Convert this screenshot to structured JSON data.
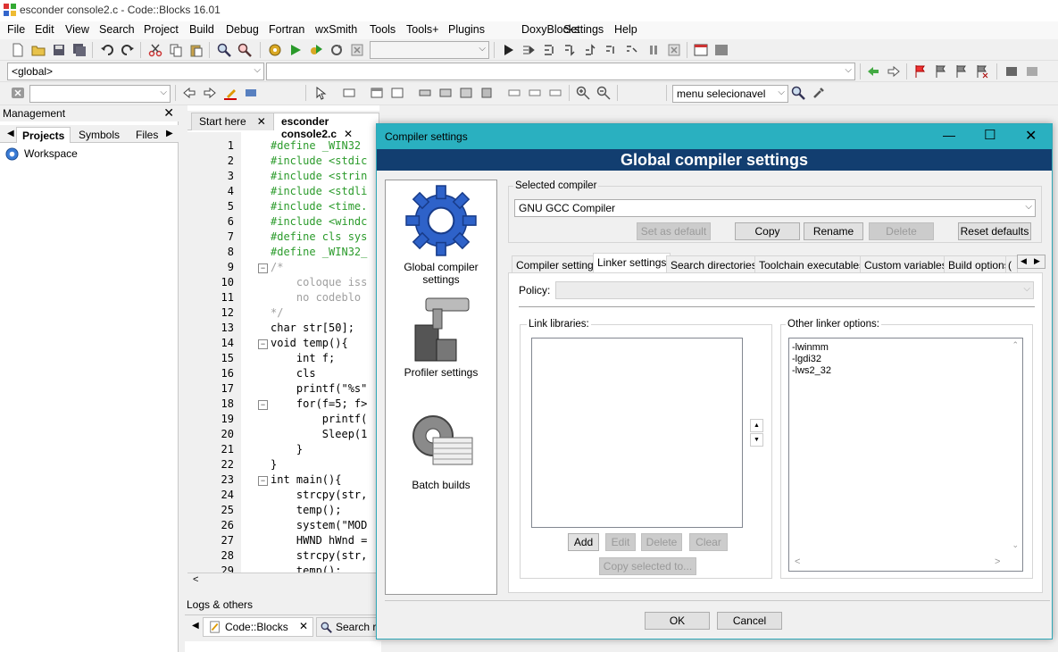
{
  "window": {
    "title": "esconder console2.c - Code::Blocks 16.01"
  },
  "menu": [
    "File",
    "Edit",
    "View",
    "Search",
    "Project",
    "Build",
    "Debug",
    "Fortran",
    "wxSmith",
    "Tools",
    "Tools+",
    "Plugins",
    "DoxyBlocks",
    "Settings",
    "Help"
  ],
  "toolbar": {
    "scope_combo": "<global>",
    "find_combo": "menu  selecionavel"
  },
  "management": {
    "title": "Management",
    "tabs": [
      "Projects",
      "Symbols",
      "Files"
    ],
    "tree_root": "Workspace"
  },
  "editor": {
    "tabs": [
      "Start here",
      "esconder console2.c"
    ],
    "lines": [
      {
        "n": "1",
        "text": "#define _WIN32",
        "cls": "pp"
      },
      {
        "n": "2",
        "text": "#include <stdic",
        "cls": "pp"
      },
      {
        "n": "3",
        "text": "#include <strin",
        "cls": "pp"
      },
      {
        "n": "4",
        "text": "#include <stdli",
        "cls": "pp"
      },
      {
        "n": "5",
        "text": "#include <time.",
        "cls": "pp"
      },
      {
        "n": "6",
        "text": "#include <windc",
        "cls": "pp"
      },
      {
        "n": "7",
        "text": "#define cls sys",
        "cls": "pp"
      },
      {
        "n": "8",
        "text": "#define _WIN32_",
        "cls": "pp"
      },
      {
        "n": "9",
        "text": "/*",
        "cls": "cmt"
      },
      {
        "n": "10",
        "text": "    coloque iss",
        "cls": "cmt"
      },
      {
        "n": "11",
        "text": "    no codeblo",
        "cls": "cmt"
      },
      {
        "n": "12",
        "text": "*/",
        "cls": "cmt"
      },
      {
        "n": "13",
        "text": "char str[50];",
        "cls": ""
      },
      {
        "n": "14",
        "text": "void temp(){",
        "cls": ""
      },
      {
        "n": "15",
        "text": "    int f;",
        "cls": ""
      },
      {
        "n": "16",
        "text": "    cls",
        "cls": ""
      },
      {
        "n": "17",
        "text": "    printf(\"%s\"",
        "cls": ""
      },
      {
        "n": "18",
        "text": "    for(f=5; f>",
        "cls": ""
      },
      {
        "n": "19",
        "text": "        printf(",
        "cls": ""
      },
      {
        "n": "20",
        "text": "        Sleep(1",
        "cls": ""
      },
      {
        "n": "21",
        "text": "    }",
        "cls": ""
      },
      {
        "n": "22",
        "text": "}",
        "cls": ""
      },
      {
        "n": "23",
        "text": "int main(){",
        "cls": ""
      },
      {
        "n": "24",
        "text": "    strcpy(str,",
        "cls": ""
      },
      {
        "n": "25",
        "text": "    temp();",
        "cls": ""
      },
      {
        "n": "26",
        "text": "    system(\"MOD",
        "cls": ""
      },
      {
        "n": "27",
        "text": "    HWND hWnd =",
        "cls": ""
      },
      {
        "n": "28",
        "text": "    strcpy(str,",
        "cls": ""
      },
      {
        "n": "29",
        "text": "    temp();",
        "cls": ""
      }
    ]
  },
  "logs": {
    "title": "Logs & others",
    "tabs": [
      "Code::Blocks",
      "Search re"
    ]
  },
  "dialog": {
    "title": "Compiler settings",
    "banner": "Global compiler settings",
    "categories": [
      "Global compiler settings",
      "Profiler settings",
      "Batch builds"
    ],
    "selected_compiler_label": "Selected compiler",
    "selected_compiler": "GNU GCC Compiler",
    "buttons": {
      "set_default": "Set as default",
      "copy": "Copy",
      "rename": "Rename",
      "delete": "Delete",
      "reset": "Reset defaults"
    },
    "tabs": [
      "Compiler settings",
      "Linker settings",
      "Search directories",
      "Toolchain executables",
      "Custom variables",
      "Build options",
      "("
    ],
    "policy_label": "Policy:",
    "link_libraries_label": "Link libraries:",
    "other_linker_label": "Other linker options:",
    "other_linker_options": [
      "-lwinmm",
      "-lgdi32",
      "-lws2_32"
    ],
    "lib_buttons": {
      "add": "Add",
      "edit": "Edit",
      "delete": "Delete",
      "clear": "Clear",
      "copy_selected": "Copy selected to..."
    },
    "ok": "OK",
    "cancel": "Cancel"
  }
}
